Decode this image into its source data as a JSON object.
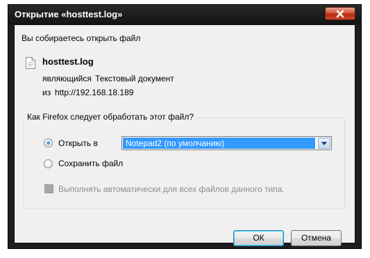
{
  "dialog": {
    "title": "Открытие «hosttest.log»",
    "intro": "Вы собираетесь открыть файл",
    "file_name": "hosttest.log",
    "type_prefix": "являющийся",
    "file_type": "Текстовый документ",
    "source_prefix": "из",
    "source_url": "http://192.168.18.189",
    "action_question": "Как Firefox следует обработать этот файл?",
    "open_with_label": "Открыть в",
    "open_with_value": "Notepad2 (по умолчанию)",
    "save_label": "Сохранить файл",
    "auto_label": "Выполнять автоматически для всех файлов данного типа.",
    "ok_label": "ОК",
    "cancel_label": "Отмена"
  },
  "icons": {
    "close": "close-icon",
    "file": "text-file-icon",
    "dropdown": "chevron-down-icon"
  },
  "colors": {
    "titlebar": "#1e1e1e",
    "client_bg": "#f0f0f0",
    "selection": "#3399ff",
    "close_button": "#c94a2b"
  }
}
